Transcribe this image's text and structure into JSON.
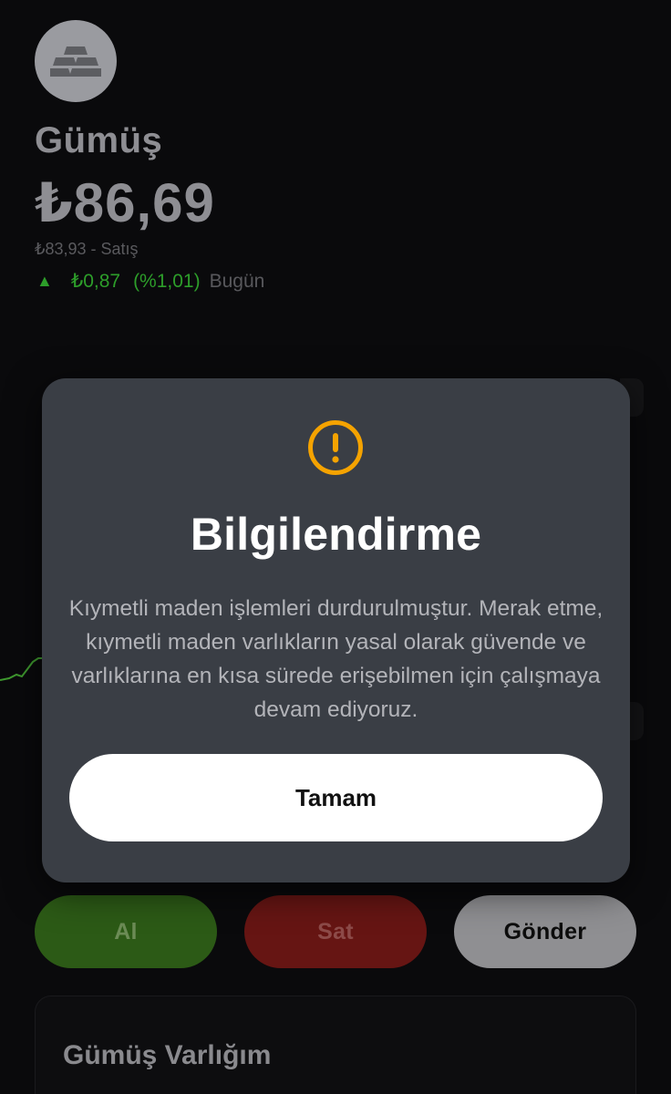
{
  "asset": {
    "icon": "silver-bars-icon",
    "name": "Gümüş",
    "price": "₺86,69",
    "sell_line": "₺83,93 - Satış",
    "change_amount": "₺0,87",
    "change_percent": "(%1,01)",
    "change_period": "Bugün",
    "change_direction": "up"
  },
  "actions": {
    "buy_label": "Al",
    "sell_label": "Sat",
    "send_label": "Gönder"
  },
  "holdings": {
    "title": "Gümüş Varlığım"
  },
  "modal": {
    "icon": "warning-icon",
    "title": "Bilgilendirme",
    "body": "Kıymetli maden işlemleri durdurulmuştur. Merak etme, kıymetli maden varlıkların yasal olarak güvende ve varlıklarına en kısa sürede erişebilmen için çalışmaya devam ediyoruz.",
    "ok_label": "Tamam"
  },
  "colors": {
    "background": "#0a0a0c",
    "modal_bg": "#3a3e45",
    "positive": "#2d9e2a",
    "warning": "#f5a300",
    "buy": "#2c5a16",
    "sell": "#661513",
    "send": "#8f8f92"
  }
}
